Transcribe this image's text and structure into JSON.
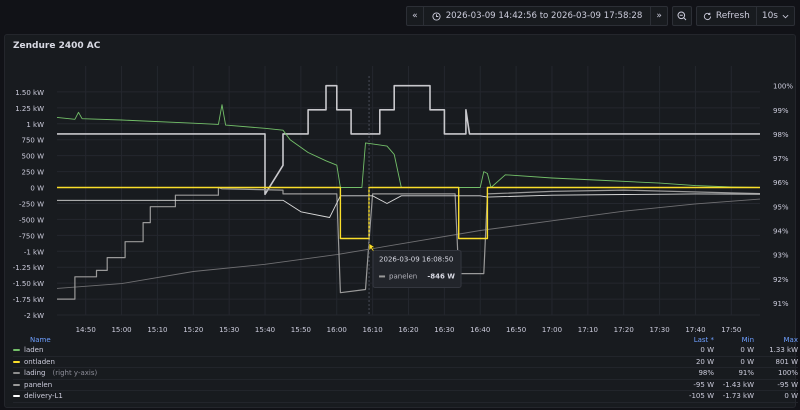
{
  "toolbar": {
    "nav_back": "«",
    "time_range": "2026-03-09 14:42:56 to 2026-03-09 17:58:28",
    "nav_forward": "»",
    "zoom_out": "⊖",
    "refresh_label": "Refresh",
    "refresh_interval": "10s",
    "clock_icon": "clock-icon",
    "refresh_icon": "refresh-icon"
  },
  "panel": {
    "title": "Zendure 2400 AC"
  },
  "chart_data": {
    "type": "line",
    "title": "Zendure 2400 AC",
    "x_ticks": [
      "14:50",
      "15:00",
      "15:10",
      "15:20",
      "15:30",
      "15:40",
      "15:50",
      "16:00",
      "16:10",
      "16:20",
      "16:30",
      "16:40",
      "16:50",
      "17:00",
      "17:10",
      "17:20",
      "17:30",
      "17:40",
      "17:50"
    ],
    "y_left_ticks": [
      "1.50 kW",
      "1.25 kW",
      "1 kW",
      "750 W",
      "500 W",
      "250 W",
      "0 W",
      "-250 W",
      "-500 W",
      "-750 W",
      "-1 kW",
      "-1.25 kW",
      "-1.50 kW",
      "-1.75 kW",
      "-2 kW"
    ],
    "y_right_ticks": [
      "100%",
      "99%",
      "98%",
      "97%",
      "96%",
      "95%",
      "94%",
      "93%",
      "92%",
      "91%"
    ],
    "ylim_left_watts": [
      -2000,
      1750
    ],
    "ylim_right_percent": [
      90.5,
      100.4
    ],
    "grid": true,
    "series": [
      {
        "name": "laden",
        "color": "#73bf69",
        "axis": "left",
        "points": [
          [
            "14:42",
            1100
          ],
          [
            "14:47",
            1070
          ],
          [
            "14:48",
            1180
          ],
          [
            "14:49",
            1080
          ],
          [
            "15:00",
            1060
          ],
          [
            "15:20",
            1010
          ],
          [
            "15:27",
            990
          ],
          [
            "15:28",
            1300
          ],
          [
            "15:29",
            980
          ],
          [
            "15:40",
            930
          ],
          [
            "15:45",
            900
          ],
          [
            "15:47",
            750
          ],
          [
            "15:52",
            550
          ],
          [
            "15:57",
            420
          ],
          [
            "16:00",
            350
          ],
          [
            "16:01",
            0
          ],
          [
            "16:07",
            0
          ],
          [
            "16:08",
            700
          ],
          [
            "16:14",
            650
          ],
          [
            "16:16",
            520
          ],
          [
            "16:18",
            0
          ],
          [
            "16:40",
            0
          ],
          [
            "16:41",
            250
          ],
          [
            "16:42",
            220
          ],
          [
            "16:43",
            0
          ],
          [
            "16:47",
            200
          ],
          [
            "17:00",
            150
          ],
          [
            "17:15",
            110
          ],
          [
            "17:30",
            70
          ],
          [
            "17:40",
            30
          ],
          [
            "17:50",
            10
          ],
          [
            "17:58",
            0
          ]
        ]
      },
      {
        "name": "ontladen",
        "color": "#fade2a",
        "axis": "left",
        "points": [
          [
            "14:42",
            0
          ],
          [
            "16:01",
            0
          ],
          [
            "16:01",
            -800
          ],
          [
            "16:09",
            -800
          ],
          [
            "16:09",
            0
          ],
          [
            "16:34",
            0
          ],
          [
            "16:34",
            -800
          ],
          [
            "16:42",
            -800
          ],
          [
            "16:42",
            0
          ],
          [
            "17:58",
            0
          ]
        ]
      },
      {
        "name": "lading",
        "color": "#8e8e8e",
        "axis": "right",
        "suffix": "(right y-axis)",
        "points": [
          [
            "14:42",
            91.6
          ],
          [
            "15:00",
            91.8
          ],
          [
            "15:20",
            92.3
          ],
          [
            "15:40",
            92.6
          ],
          [
            "16:00",
            93.0
          ],
          [
            "16:20",
            93.5
          ],
          [
            "16:40",
            94.0
          ],
          [
            "17:00",
            94.4
          ],
          [
            "17:20",
            94.8
          ],
          [
            "17:40",
            95.1
          ],
          [
            "17:58",
            95.3
          ]
        ]
      },
      {
        "name": "panelen",
        "color": "#9a9a9a",
        "axis": "left",
        "points": [
          [
            "14:42",
            -1750
          ],
          [
            "14:47",
            -1750
          ],
          [
            "14:47",
            -1400
          ],
          [
            "14:53",
            -1400
          ],
          [
            "14:53",
            -1300
          ],
          [
            "14:56",
            -1300
          ],
          [
            "14:56",
            -1100
          ],
          [
            "15:01",
            -1100
          ],
          [
            "15:01",
            -850
          ],
          [
            "15:06",
            -850
          ],
          [
            "15:06",
            -550
          ],
          [
            "15:08",
            -550
          ],
          [
            "15:08",
            -300
          ],
          [
            "15:15",
            -300
          ],
          [
            "15:15",
            -120
          ],
          [
            "15:27",
            -120
          ],
          [
            "15:27",
            0
          ],
          [
            "15:28",
            -20
          ],
          [
            "15:45",
            -40
          ],
          [
            "15:45",
            -100
          ],
          [
            "16:00",
            -100
          ],
          [
            "16:01",
            -1650
          ],
          [
            "16:08",
            -1600
          ],
          [
            "16:09",
            -846
          ],
          [
            "16:10",
            -100
          ],
          [
            "16:33",
            -100
          ],
          [
            "16:34",
            -1350
          ],
          [
            "16:41",
            -1350
          ],
          [
            "16:42",
            -100
          ],
          [
            "17:00",
            -60
          ],
          [
            "17:20",
            -40
          ],
          [
            "17:58",
            -95
          ]
        ]
      },
      {
        "name": "delivery-L1",
        "color": "#ffffff",
        "axis": "left",
        "points": [
          [
            "14:42",
            -200
          ],
          [
            "15:00",
            -200
          ],
          [
            "15:27",
            -200
          ],
          [
            "15:45",
            -200
          ],
          [
            "15:50",
            -380
          ],
          [
            "15:58",
            -470
          ],
          [
            "16:01",
            -130
          ],
          [
            "16:10",
            -130
          ],
          [
            "16:14",
            -250
          ],
          [
            "16:18",
            -130
          ],
          [
            "16:40",
            -130
          ],
          [
            "16:42",
            -150
          ],
          [
            "17:00",
            -120
          ],
          [
            "17:20",
            -110
          ],
          [
            "17:40",
            -100
          ],
          [
            "17:58",
            -105
          ]
        ]
      }
    ],
    "lading_steps": [
      [
        "14:42",
        98.0
      ],
      [
        "15:40",
        98.0
      ],
      [
        "15:40",
        95.5
      ],
      [
        "15:45",
        96.7
      ],
      [
        "15:45",
        98.0
      ],
      [
        "15:52",
        98.0
      ],
      [
        "15:52",
        99.0
      ],
      [
        "15:57",
        99.0
      ],
      [
        "15:57",
        100.0
      ],
      [
        "16:00",
        100.0
      ],
      [
        "16:00",
        99.0
      ],
      [
        "16:04",
        99.0
      ],
      [
        "16:04",
        98.0
      ],
      [
        "16:12",
        98.0
      ],
      [
        "16:12",
        99.0
      ],
      [
        "16:16",
        99.0
      ],
      [
        "16:16",
        100.0
      ],
      [
        "16:26",
        100.0
      ],
      [
        "16:26",
        99.0
      ],
      [
        "16:30",
        99.0
      ],
      [
        "16:30",
        98.0
      ],
      [
        "16:36",
        98.0
      ],
      [
        "16:36",
        99.0
      ],
      [
        "16:37",
        98.0
      ],
      [
        "17:58",
        98.0
      ]
    ]
  },
  "tooltip": {
    "time": "2026-03-09 16:08:50",
    "series": "panelen",
    "value": "-846 W"
  },
  "legend": {
    "columns": {
      "name": "Name",
      "last": "Last *",
      "min": "Min",
      "max": "Max"
    },
    "rows": [
      {
        "name": "laden",
        "suffix": "",
        "color": "#73bf69",
        "last": "0 W",
        "min": "0 W",
        "max": "1.33 kW"
      },
      {
        "name": "ontladen",
        "suffix": "",
        "color": "#fade2a",
        "last": "20 W",
        "min": "0 W",
        "max": "801 W"
      },
      {
        "name": "lading",
        "suffix": "(right y-axis)",
        "color": "#8e8e8e",
        "last": "98%",
        "min": "91%",
        "max": "100%"
      },
      {
        "name": "panelen",
        "suffix": "",
        "color": "#9a9a9a",
        "last": "-95 W",
        "min": "-1.43 kW",
        "max": "-95 W"
      },
      {
        "name": "delivery-L1",
        "suffix": "",
        "color": "#ffffff",
        "last": "-105 W",
        "min": "-1.73 kW",
        "max": "0 W"
      }
    ]
  }
}
